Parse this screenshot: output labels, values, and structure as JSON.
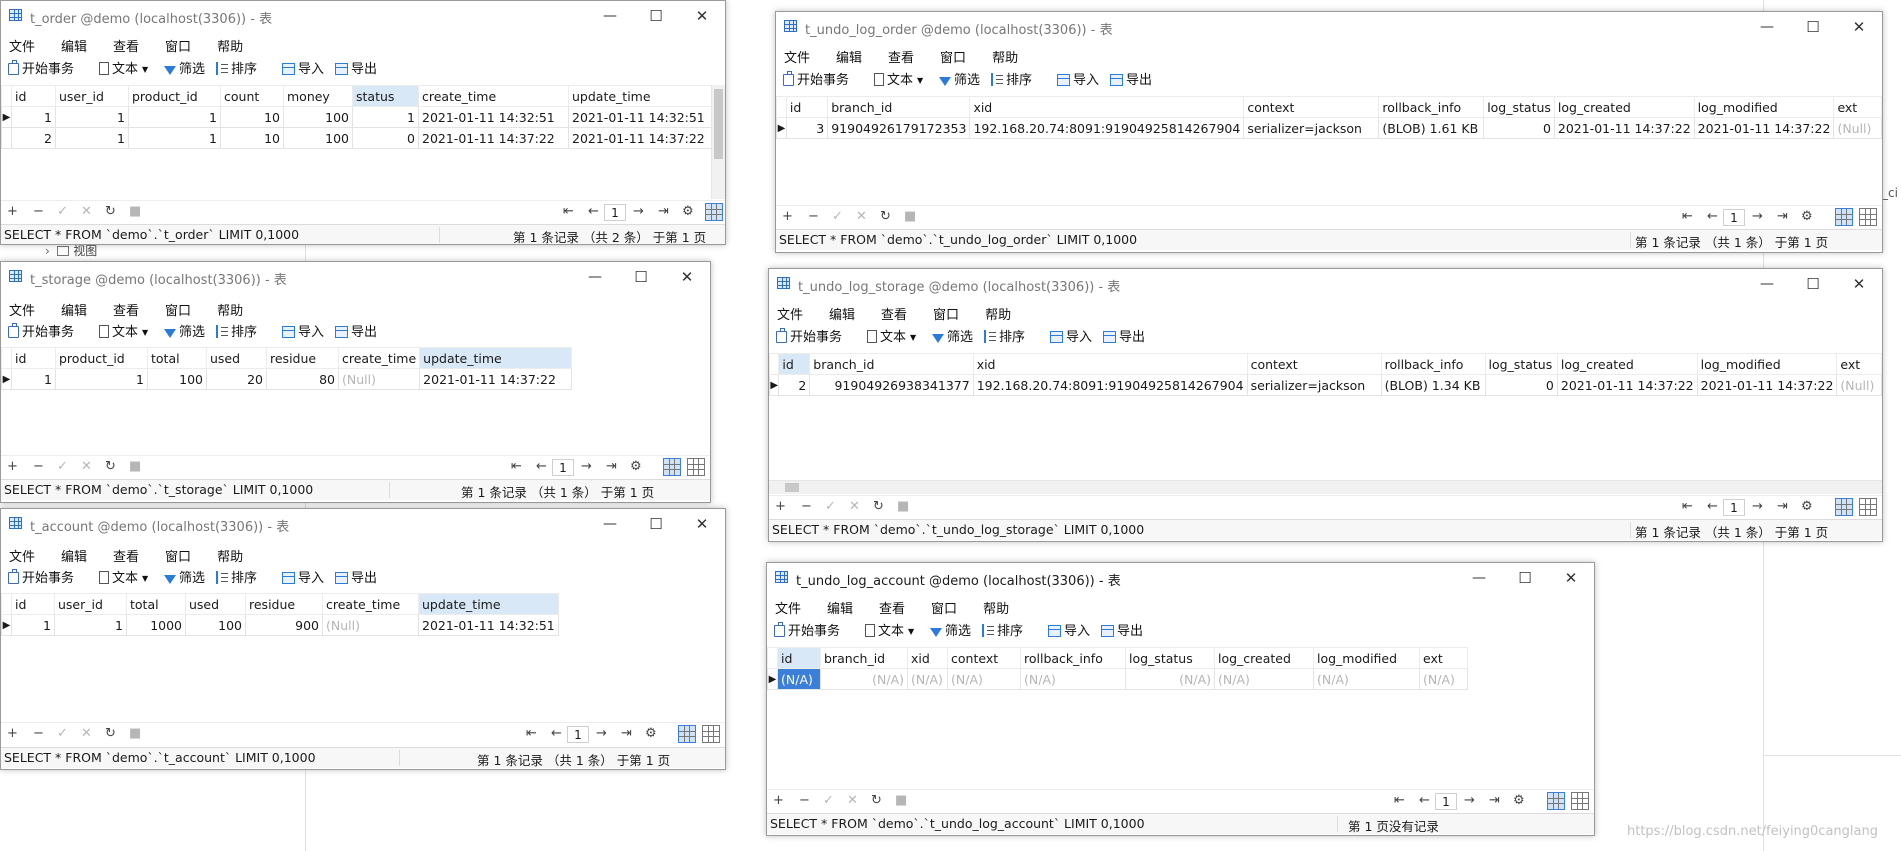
{
  "background": {
    "tree_item": "视图",
    "right_edge_text": "_ci",
    "watermark": "https://blog.csdn.net/feiying0canglang"
  },
  "common": {
    "menu": [
      "文件",
      "编辑",
      "查看",
      "窗口",
      "帮助"
    ],
    "toolbar": {
      "begin_tx": "开始事务",
      "text": "文本",
      "filter": "筛选",
      "sort": "排序",
      "import": "导入",
      "export": "导出"
    },
    "nav": {
      "add": "+",
      "remove": "−",
      "apply": "✓",
      "discard": "✕",
      "refresh": "↻",
      "stop": "■",
      "first": "⇤",
      "prev": "←",
      "page": "1",
      "next": "→",
      "last": "⇥",
      "settings": "⚙"
    },
    "marker": "▶"
  },
  "windows": {
    "t_order": {
      "title": "t_order @demo (localhost(3306)) - 表",
      "columns": [
        "id",
        "user_id",
        "product_id",
        "count",
        "money",
        "status",
        "create_time",
        "update_time"
      ],
      "rows": [
        [
          "1",
          "1",
          "1",
          "10",
          "100",
          "1",
          "2021-01-11 14:32:51",
          "2021-01-11 14:32:51"
        ],
        [
          "2",
          "1",
          "1",
          "10",
          "100",
          "0",
          "2021-01-11 14:37:22",
          "2021-01-11 14:37:22"
        ]
      ],
      "sql": "SELECT * FROM `demo`.`t_order` LIMIT 0,1000",
      "record_info": "第 1 条记录 （共 2 条） 于第 1 页"
    },
    "t_storage": {
      "title": "t_storage @demo (localhost(3306)) - 表",
      "columns": [
        "id",
        "product_id",
        "total",
        "used",
        "residue",
        "create_time",
        "update_time"
      ],
      "rows": [
        [
          "1",
          "1",
          "100",
          "20",
          "80",
          "(Null)",
          "2021-01-11 14:37:22"
        ]
      ],
      "sql": "SELECT * FROM `demo`.`t_storage` LIMIT 0,1000",
      "record_info": "第 1 条记录 （共 1 条） 于第 1 页"
    },
    "t_account": {
      "title": "t_account @demo (localhost(3306)) - 表",
      "columns": [
        "id",
        "user_id",
        "total",
        "used",
        "residue",
        "create_time",
        "update_time"
      ],
      "rows": [
        [
          "1",
          "1",
          "1000",
          "100",
          "900",
          "(Null)",
          "2021-01-11 14:32:51"
        ]
      ],
      "sql": "SELECT * FROM `demo`.`t_account` LIMIT 0,1000",
      "record_info": "第 1 条记录 （共 1 条） 于第 1 页"
    },
    "t_undo_log_order": {
      "title": "t_undo_log_order @demo (localhost(3306)) - 表",
      "columns": [
        "id",
        "branch_id",
        "xid",
        "context",
        "rollback_info",
        "log_status",
        "log_created",
        "log_modified",
        "ext"
      ],
      "rows": [
        [
          "3",
          "91904926179172353",
          "192.168.20.74:8091:91904925814267904",
          "serializer=jackson",
          "(BLOB) 1.61 KB",
          "0",
          "2021-01-11 14:37:22",
          "2021-01-11 14:37:22",
          "(Null)"
        ]
      ],
      "sql": "SELECT * FROM `demo`.`t_undo_log_order` LIMIT 0,1000",
      "record_info": "第 1 条记录 （共 1 条） 于第 1 页"
    },
    "t_undo_log_storage": {
      "title": "t_undo_log_storage @demo (localhost(3306)) - 表",
      "columns": [
        "id",
        "branch_id",
        "xid",
        "context",
        "rollback_info",
        "log_status",
        "log_created",
        "log_modified",
        "ext"
      ],
      "rows": [
        [
          "2",
          "91904926938341377",
          "192.168.20.74:8091:91904925814267904",
          "serializer=jackson",
          "(BLOB) 1.34 KB",
          "0",
          "2021-01-11 14:37:22",
          "2021-01-11 14:37:22",
          "(Null)"
        ]
      ],
      "sql": "SELECT * FROM `demo`.`t_undo_log_storage` LIMIT 0,1000",
      "record_info": "第 1 条记录 （共 1 条） 于第 1 页"
    },
    "t_undo_log_account": {
      "title": "t_undo_log_account @demo (localhost(3306)) - 表",
      "columns": [
        "id",
        "branch_id",
        "xid",
        "context",
        "rollback_info",
        "log_status",
        "log_created",
        "log_modified",
        "ext"
      ],
      "rows": [
        [
          "(N/A)",
          "(N/A)",
          "(N/A)",
          "(N/A)",
          "(N/A)",
          "(N/A)",
          "(N/A)",
          "(N/A)",
          "(N/A)"
        ]
      ],
      "sql": "SELECT * FROM `demo`.`t_undo_log_account` LIMIT 0,1000",
      "record_info": "第 1 页没有记录"
    }
  }
}
